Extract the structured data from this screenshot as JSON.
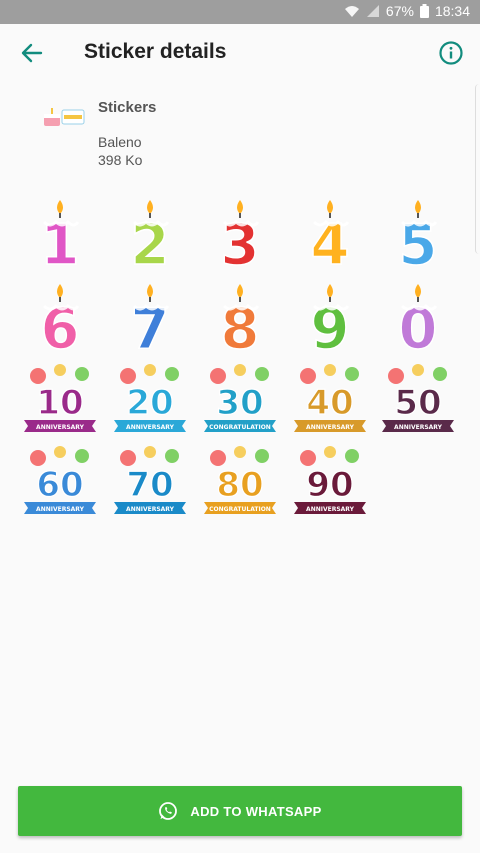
{
  "status_bar": {
    "battery": "67%",
    "time": "18:34",
    "icons": [
      "wifi-icon",
      "signal-icon",
      "battery-icon"
    ]
  },
  "app_bar": {
    "title": "Sticker details",
    "back_icon": "arrow-back-icon",
    "info_icon": "info-icon"
  },
  "pack": {
    "name": "Stickers",
    "publisher": "Baleno",
    "size": "398 Ko",
    "tray_icon": "birthday-cake-icon"
  },
  "stickers": [
    {
      "label": "1",
      "kind": "candle",
      "color": "#e056c6"
    },
    {
      "label": "2",
      "kind": "candle",
      "color": "#a8d64a"
    },
    {
      "label": "3",
      "kind": "candle",
      "color": "#e33232"
    },
    {
      "label": "4",
      "kind": "candle",
      "color": "#ffb21f"
    },
    {
      "label": "5",
      "kind": "candle",
      "color": "#4aa8e8"
    },
    {
      "label": "6",
      "kind": "candle",
      "color": "#f05fa8"
    },
    {
      "label": "7",
      "kind": "candle",
      "color": "#3f7fd9"
    },
    {
      "label": "8",
      "kind": "candle",
      "color": "#f07a3a"
    },
    {
      "label": "9",
      "kind": "candle",
      "color": "#5fbf3f"
    },
    {
      "label": "0",
      "kind": "candle",
      "color": "#c07ad8"
    },
    {
      "label": "10",
      "kind": "anniversary",
      "color": "#9a2a8a",
      "ribbon": "ANNIVERSARY"
    },
    {
      "label": "20",
      "kind": "anniversary",
      "color": "#2aa8d8",
      "ribbon": "ANNIVERSARY"
    },
    {
      "label": "30",
      "kind": "anniversary",
      "color": "#22a0c8",
      "ribbon": "CONGRATULATION"
    },
    {
      "label": "40",
      "kind": "anniversary",
      "color": "#d89a2a",
      "ribbon": "ANNIVERSARY"
    },
    {
      "label": "50",
      "kind": "anniversary",
      "color": "#5a2a4a",
      "ribbon": "ANNIVERSARY"
    },
    {
      "label": "60",
      "kind": "anniversary",
      "color": "#3a8ad8",
      "ribbon": "ANNIVERSARY"
    },
    {
      "label": "70",
      "kind": "anniversary",
      "color": "#1a8ac8",
      "ribbon": "ANNIVERSARY"
    },
    {
      "label": "80",
      "kind": "anniversary",
      "color": "#e8a020",
      "ribbon": "CONGRATULATION"
    },
    {
      "label": "90",
      "kind": "anniversary",
      "color": "#6a1a3a",
      "ribbon": "ANNIVERSARY"
    }
  ],
  "add_button": {
    "label": "ADD TO WHATSAPP",
    "icon": "whatsapp-icon"
  },
  "colors": {
    "accent": "#128c7e",
    "button": "#43b83e",
    "status_bar": "#9e9e9e"
  }
}
